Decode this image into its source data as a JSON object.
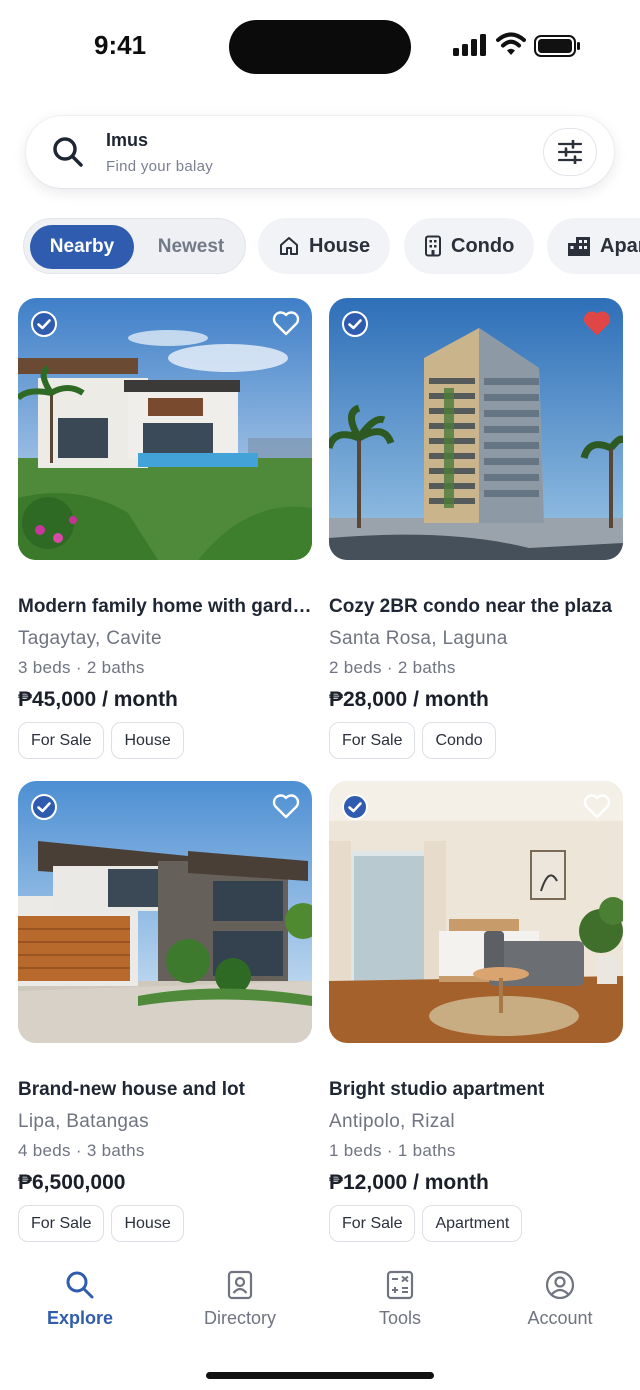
{
  "status": {
    "time": "9:41"
  },
  "search": {
    "location": "Imus",
    "placeholder": "Find your balay"
  },
  "sort": {
    "active": "Nearby",
    "inactive": "Newest"
  },
  "chips": [
    {
      "label": "House",
      "icon": "house-icon"
    },
    {
      "label": "Condo",
      "icon": "condo-icon"
    },
    {
      "label": "Apartment",
      "icon": "apartment-icon"
    }
  ],
  "listings": [
    {
      "title": "Modern family home with garden",
      "location": "Tagaytay, Cavite",
      "specs": "3 beds · 2 baths",
      "price": "₱45,000 / month",
      "tags": [
        "For Sale",
        "House"
      ],
      "verified": true,
      "favorited": false
    },
    {
      "title": "Cozy 2BR condo near the plaza",
      "location": "Santa Rosa, Laguna",
      "specs": "2 beds · 2 baths",
      "price": "₱28,000 / month",
      "tags": [
        "For Sale",
        "Condo"
      ],
      "verified": true,
      "favorited": true
    },
    {
      "title": "Brand-new house and lot",
      "location": "Lipa, Batangas",
      "specs": "4 beds · 3 baths",
      "price": "₱6,500,000",
      "tags": [
        "For Sale",
        "House"
      ],
      "verified": true,
      "favorited": false
    },
    {
      "title": "Bright studio apartment",
      "location": "Antipolo, Rizal",
      "specs": "1 beds · 1 baths",
      "price": "₱12,000 / month",
      "tags": [
        "For Sale",
        "Apartment"
      ],
      "verified": true,
      "favorited": false
    }
  ],
  "nav": [
    {
      "label": "Explore",
      "icon": "search-icon",
      "active": true
    },
    {
      "label": "Directory",
      "icon": "contact-book-icon",
      "active": false
    },
    {
      "label": "Tools",
      "icon": "calculator-icon",
      "active": false
    },
    {
      "label": "Account",
      "icon": "user-circle-icon",
      "active": false
    }
  ],
  "colors": {
    "accent": "#2f5cae",
    "favorite": "#e04646",
    "text": "#1f2633",
    "muted": "#6f7480"
  }
}
